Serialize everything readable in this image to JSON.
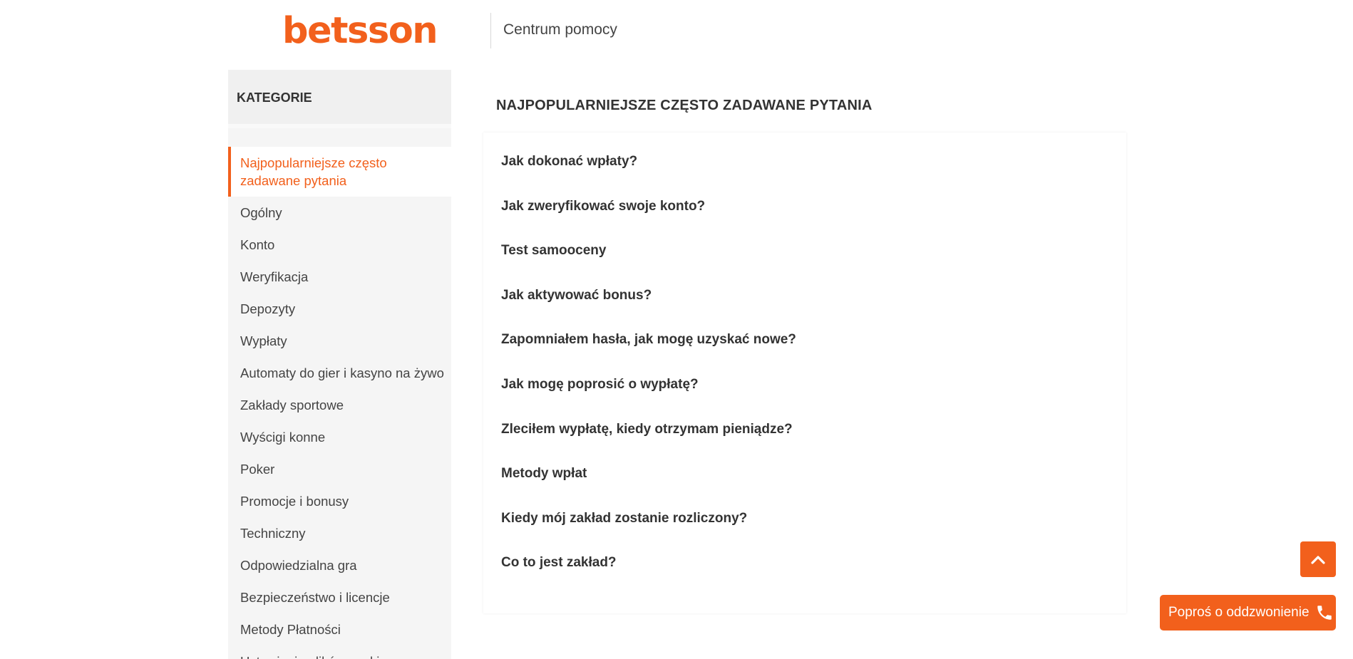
{
  "brand": {
    "logo_text": "betsson",
    "color": "#f2601c"
  },
  "header": {
    "title": "Centrum pomocy"
  },
  "sidebar": {
    "heading": "KATEGORIE",
    "items": [
      {
        "label": "Najpopularniejsze często zadawane pytania",
        "active": true
      },
      {
        "label": "Ogólny"
      },
      {
        "label": "Konto"
      },
      {
        "label": "Weryfikacja"
      },
      {
        "label": "Depozyty"
      },
      {
        "label": "Wypłaty"
      },
      {
        "label": "Automaty do gier i kasyno na żywo"
      },
      {
        "label": "Zakłady sportowe"
      },
      {
        "label": "Wyścigi konne"
      },
      {
        "label": "Poker"
      },
      {
        "label": "Promocje i bonusy"
      },
      {
        "label": "Techniczny"
      },
      {
        "label": "Odpowiedzialna gra"
      },
      {
        "label": "Bezpieczeństwo i licencje"
      },
      {
        "label": "Metody Płatności"
      },
      {
        "label": "Ustawienia plików cookie"
      }
    ]
  },
  "main": {
    "title": "NAJPOPULARNIEJSZE CZĘSTO ZADAWANE PYTANIA",
    "faq": [
      "Jak dokonać wpłaty?",
      "Jak zweryfikować swoje konto?",
      "Test samooceny",
      "Jak aktywować bonus?",
      "Zapomniałem hasła, jak mogę uzyskać nowe?",
      "Jak mogę poprosić o wypłatę?",
      "Zleciłem wypłatę, kiedy otrzymam pieniądze?",
      "Metody wpłat",
      "Kiedy mój zakład zostanie rozliczony?",
      "Co to jest zakład?"
    ]
  },
  "floating": {
    "scroll_top_icon": "chevron-up-icon",
    "callback_label": "Poproś o oddzwonienie",
    "callback_icon": "phone-icon"
  }
}
